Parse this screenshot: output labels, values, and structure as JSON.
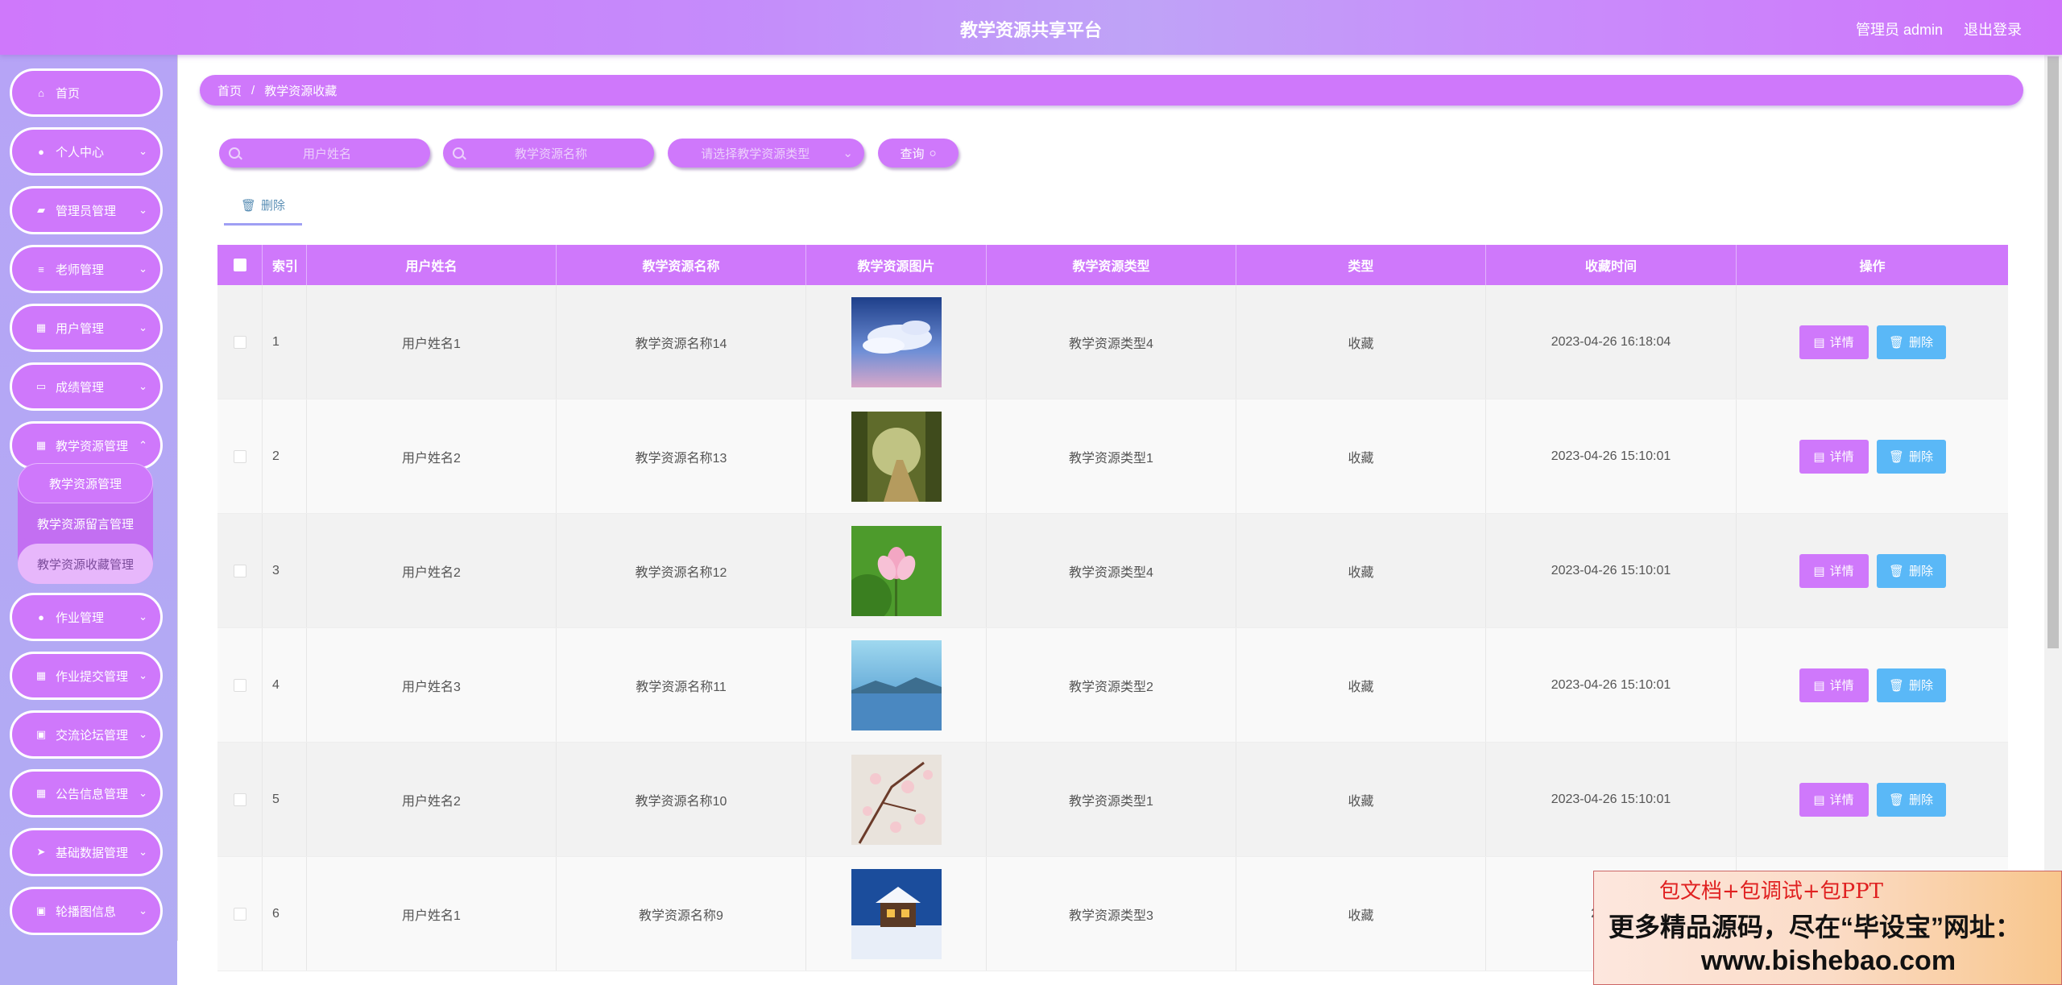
{
  "header": {
    "title": "教学资源共享平台",
    "user": "管理员 admin",
    "logout": "退出登录"
  },
  "sidebar": {
    "items": [
      {
        "label": "首页",
        "icon": "home-icon"
      },
      {
        "label": "个人中心",
        "icon": "user-icon"
      },
      {
        "label": "管理员管理",
        "icon": "folder-icon"
      },
      {
        "label": "老师管理",
        "icon": "list-icon"
      },
      {
        "label": "用户管理",
        "icon": "grid-icon"
      },
      {
        "label": "成绩管理",
        "icon": "monitor-icon"
      },
      {
        "label": "教学资源管理",
        "icon": "grid-icon"
      },
      {
        "label": "作业管理",
        "icon": "user-icon"
      },
      {
        "label": "作业提交管理",
        "icon": "grid-icon"
      },
      {
        "label": "交流论坛管理",
        "icon": "clipboard-icon"
      },
      {
        "label": "公告信息管理",
        "icon": "grid-icon"
      },
      {
        "label": "基础数据管理",
        "icon": "send-icon"
      },
      {
        "label": "轮播图信息",
        "icon": "clipboard-icon"
      }
    ],
    "submenu": [
      "教学资源管理",
      "教学资源留言管理",
      "教学资源收藏管理"
    ]
  },
  "breadcrumb": {
    "home": "首页",
    "sep": "/",
    "current": "教学资源收藏"
  },
  "search": {
    "user_placeholder": "用户姓名",
    "name_placeholder": "教学资源名称",
    "type_placeholder": "请选择教学资源类型",
    "query_label": "查询"
  },
  "toolbar": {
    "delete_label": "删除"
  },
  "table": {
    "headers": [
      "索引",
      "用户姓名",
      "教学资源名称",
      "教学资源图片",
      "教学资源类型",
      "类型",
      "收藏时间",
      "操作"
    ],
    "rows": [
      {
        "idx": "1",
        "user": "用户姓名1",
        "name": "教学资源名称14",
        "type": "教学资源类型4",
        "kind": "收藏",
        "time": "2023-04-26 16:18:04",
        "image": "sky-clouds"
      },
      {
        "idx": "2",
        "user": "用户姓名2",
        "name": "教学资源名称13",
        "type": "教学资源类型1",
        "kind": "收藏",
        "time": "2023-04-26 15:10:01",
        "image": "forest-path"
      },
      {
        "idx": "3",
        "user": "用户姓名2",
        "name": "教学资源名称12",
        "type": "教学资源类型4",
        "kind": "收藏",
        "time": "2023-04-26 15:10:01",
        "image": "lotus-flower"
      },
      {
        "idx": "4",
        "user": "用户姓名3",
        "name": "教学资源名称11",
        "type": "教学资源类型2",
        "kind": "收藏",
        "time": "2023-04-26 15:10:01",
        "image": "blue-lake"
      },
      {
        "idx": "5",
        "user": "用户姓名2",
        "name": "教学资源名称10",
        "type": "教学资源类型1",
        "kind": "收藏",
        "time": "2023-04-26 15:10:01",
        "image": "cherry-blossom"
      },
      {
        "idx": "6",
        "user": "用户姓名1",
        "name": "教学资源名称9",
        "type": "教学资源类型3",
        "kind": "收藏",
        "time": "2023-0",
        "image": "snow-cabin"
      }
    ],
    "detail_label": "详情",
    "delete_label": "删除"
  },
  "ad": {
    "line1": "包文档+包调试+包PPT",
    "line2": "更多精品源码，尽在“毕设宝”网址：",
    "line3": "www.bishebao.com"
  },
  "colors": {
    "accent": "#cf78fb",
    "sidebar": "#b6a4f6",
    "delete_btn": "#5ab8f7"
  }
}
